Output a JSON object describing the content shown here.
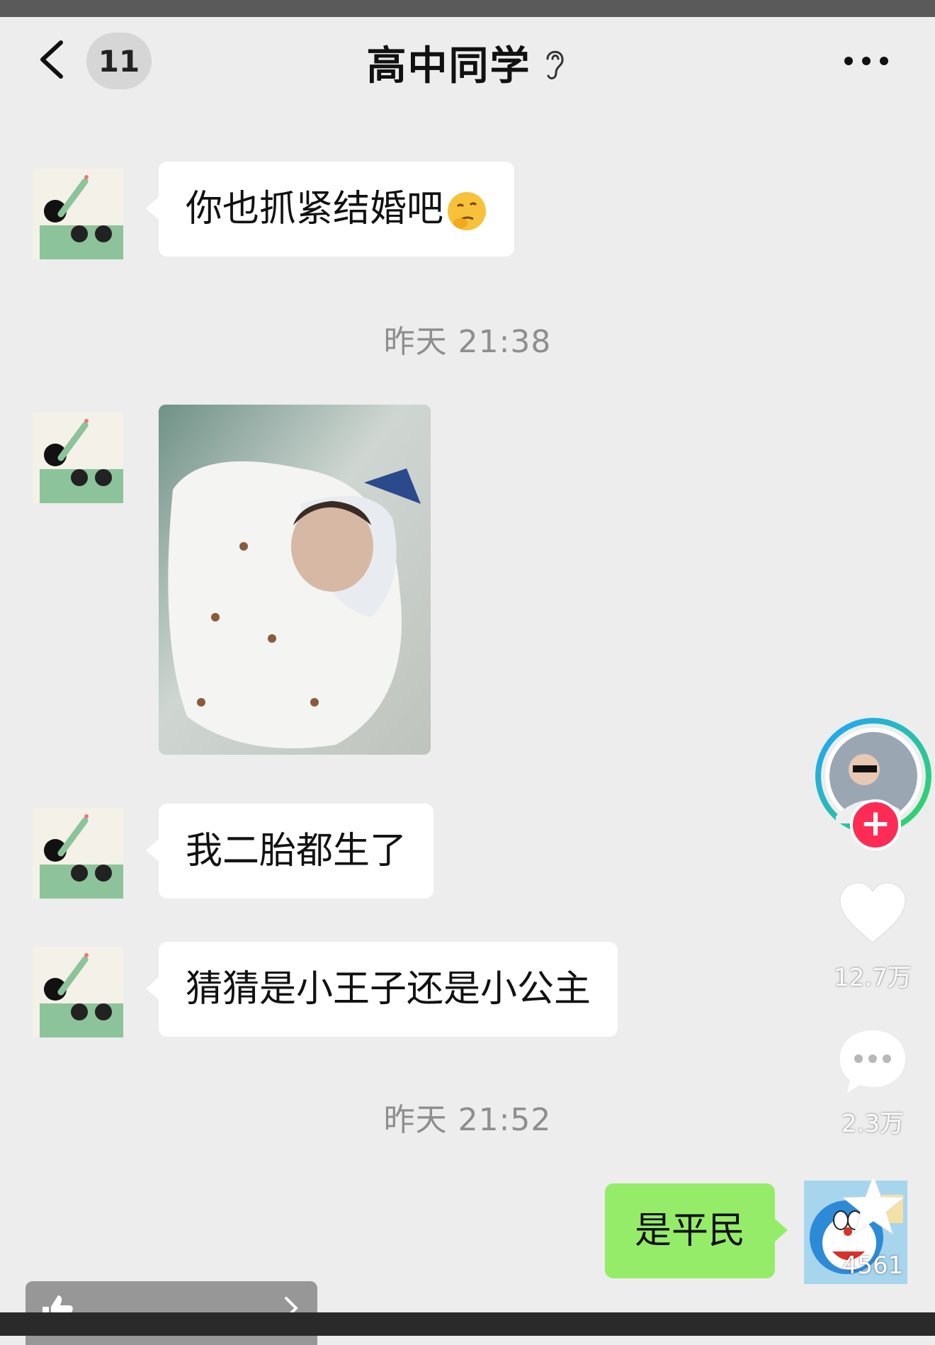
{
  "header": {
    "unread_count": "11",
    "title": "高中同学"
  },
  "messages": [
    {
      "text": "你也抓紧结婚吧"
    },
    {
      "timestamp": "昨天 21:38"
    },
    {
      "type": "image",
      "description_icon": "photo-icon"
    },
    {
      "text": "我二胎都生了"
    },
    {
      "text": "猜猜是小王子还是小公主"
    },
    {
      "timestamp": "昨天 21:52"
    },
    {
      "text": "是平民",
      "outgoing": true
    }
  ],
  "side_panel": {
    "likes": "12.7万",
    "comments": "2.3万",
    "favorites": "4561"
  },
  "colors": {
    "outgoing_bubble": "#95ec69",
    "incoming_bubble": "#ffffff",
    "follow_button": "#fe2c55",
    "background": "#ededed"
  }
}
